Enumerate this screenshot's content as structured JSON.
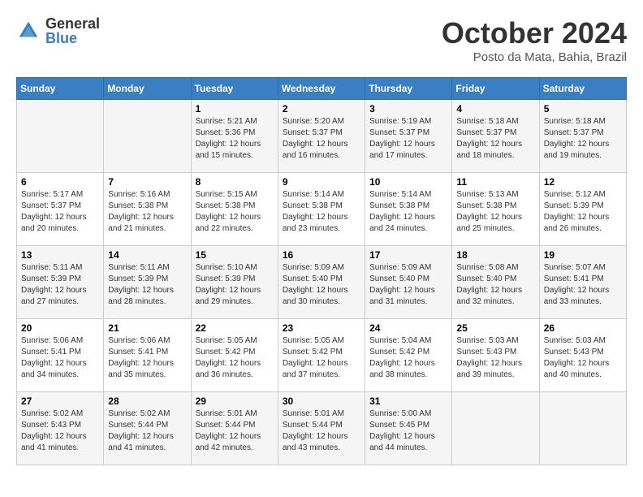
{
  "logo": {
    "general": "General",
    "blue": "Blue"
  },
  "title": "October 2024",
  "location": "Posto da Mata, Bahia, Brazil",
  "weekdays": [
    "Sunday",
    "Monday",
    "Tuesday",
    "Wednesday",
    "Thursday",
    "Friday",
    "Saturday"
  ],
  "weeks": [
    [
      {
        "day": "",
        "info": ""
      },
      {
        "day": "",
        "info": ""
      },
      {
        "day": "1",
        "sunrise": "5:21 AM",
        "sunset": "5:36 PM",
        "daylight": "12 hours and 15 minutes."
      },
      {
        "day": "2",
        "sunrise": "5:20 AM",
        "sunset": "5:37 PM",
        "daylight": "12 hours and 16 minutes."
      },
      {
        "day": "3",
        "sunrise": "5:19 AM",
        "sunset": "5:37 PM",
        "daylight": "12 hours and 17 minutes."
      },
      {
        "day": "4",
        "sunrise": "5:18 AM",
        "sunset": "5:37 PM",
        "daylight": "12 hours and 18 minutes."
      },
      {
        "day": "5",
        "sunrise": "5:18 AM",
        "sunset": "5:37 PM",
        "daylight": "12 hours and 19 minutes."
      }
    ],
    [
      {
        "day": "6",
        "sunrise": "5:17 AM",
        "sunset": "5:37 PM",
        "daylight": "12 hours and 20 minutes."
      },
      {
        "day": "7",
        "sunrise": "5:16 AM",
        "sunset": "5:38 PM",
        "daylight": "12 hours and 21 minutes."
      },
      {
        "day": "8",
        "sunrise": "5:15 AM",
        "sunset": "5:38 PM",
        "daylight": "12 hours and 22 minutes."
      },
      {
        "day": "9",
        "sunrise": "5:14 AM",
        "sunset": "5:38 PM",
        "daylight": "12 hours and 23 minutes."
      },
      {
        "day": "10",
        "sunrise": "5:14 AM",
        "sunset": "5:38 PM",
        "daylight": "12 hours and 24 minutes."
      },
      {
        "day": "11",
        "sunrise": "5:13 AM",
        "sunset": "5:38 PM",
        "daylight": "12 hours and 25 minutes."
      },
      {
        "day": "12",
        "sunrise": "5:12 AM",
        "sunset": "5:39 PM",
        "daylight": "12 hours and 26 minutes."
      }
    ],
    [
      {
        "day": "13",
        "sunrise": "5:11 AM",
        "sunset": "5:39 PM",
        "daylight": "12 hours and 27 minutes."
      },
      {
        "day": "14",
        "sunrise": "5:11 AM",
        "sunset": "5:39 PM",
        "daylight": "12 hours and 28 minutes."
      },
      {
        "day": "15",
        "sunrise": "5:10 AM",
        "sunset": "5:39 PM",
        "daylight": "12 hours and 29 minutes."
      },
      {
        "day": "16",
        "sunrise": "5:09 AM",
        "sunset": "5:40 PM",
        "daylight": "12 hours and 30 minutes."
      },
      {
        "day": "17",
        "sunrise": "5:09 AM",
        "sunset": "5:40 PM",
        "daylight": "12 hours and 31 minutes."
      },
      {
        "day": "18",
        "sunrise": "5:08 AM",
        "sunset": "5:40 PM",
        "daylight": "12 hours and 32 minutes."
      },
      {
        "day": "19",
        "sunrise": "5:07 AM",
        "sunset": "5:41 PM",
        "daylight": "12 hours and 33 minutes."
      }
    ],
    [
      {
        "day": "20",
        "sunrise": "5:06 AM",
        "sunset": "5:41 PM",
        "daylight": "12 hours and 34 minutes."
      },
      {
        "day": "21",
        "sunrise": "5:06 AM",
        "sunset": "5:41 PM",
        "daylight": "12 hours and 35 minutes."
      },
      {
        "day": "22",
        "sunrise": "5:05 AM",
        "sunset": "5:42 PM",
        "daylight": "12 hours and 36 minutes."
      },
      {
        "day": "23",
        "sunrise": "5:05 AM",
        "sunset": "5:42 PM",
        "daylight": "12 hours and 37 minutes."
      },
      {
        "day": "24",
        "sunrise": "5:04 AM",
        "sunset": "5:42 PM",
        "daylight": "12 hours and 38 minutes."
      },
      {
        "day": "25",
        "sunrise": "5:03 AM",
        "sunset": "5:43 PM",
        "daylight": "12 hours and 39 minutes."
      },
      {
        "day": "26",
        "sunrise": "5:03 AM",
        "sunset": "5:43 PM",
        "daylight": "12 hours and 40 minutes."
      }
    ],
    [
      {
        "day": "27",
        "sunrise": "5:02 AM",
        "sunset": "5:43 PM",
        "daylight": "12 hours and 41 minutes."
      },
      {
        "day": "28",
        "sunrise": "5:02 AM",
        "sunset": "5:44 PM",
        "daylight": "12 hours and 41 minutes."
      },
      {
        "day": "29",
        "sunrise": "5:01 AM",
        "sunset": "5:44 PM",
        "daylight": "12 hours and 42 minutes."
      },
      {
        "day": "30",
        "sunrise": "5:01 AM",
        "sunset": "5:44 PM",
        "daylight": "12 hours and 43 minutes."
      },
      {
        "day": "31",
        "sunrise": "5:00 AM",
        "sunset": "5:45 PM",
        "daylight": "12 hours and 44 minutes."
      },
      {
        "day": "",
        "info": ""
      },
      {
        "day": "",
        "info": ""
      }
    ]
  ]
}
